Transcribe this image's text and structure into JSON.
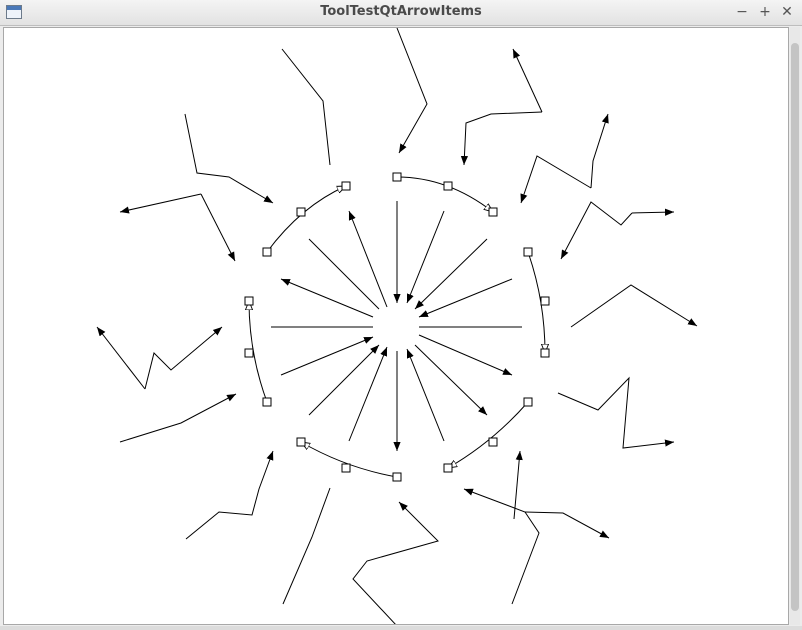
{
  "window": {
    "title": "ToolTestQtArrowItems",
    "minimize_glyph": "−",
    "maximize_glyph": "+",
    "close_glyph": "✕"
  },
  "colors": {
    "stroke": "#000000",
    "canvas_bg": "#ffffff",
    "titlebar_text": "#4a4a4a"
  },
  "icons": [
    "app-window-icon",
    "minimize-icon",
    "maximize-icon",
    "close-icon"
  ]
}
